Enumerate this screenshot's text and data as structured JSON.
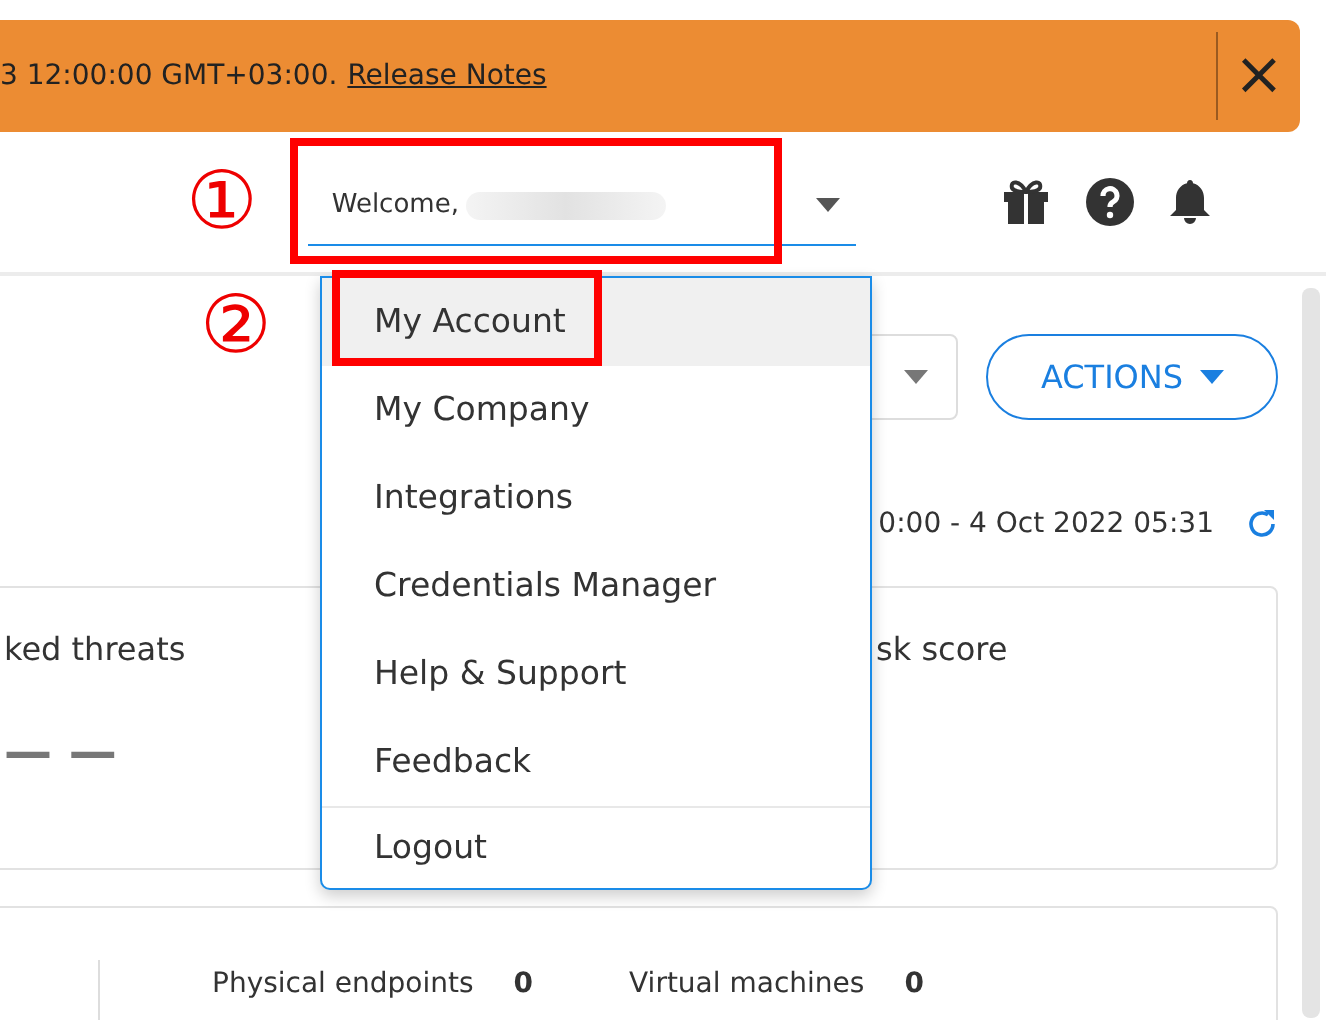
{
  "banner": {
    "text": "3 12:00:00 GMT+03:00.",
    "link": "Release Notes",
    "close": "×"
  },
  "header": {
    "welcome": "Welcome,",
    "annotation": "①"
  },
  "user_menu": {
    "annotation": "②",
    "items": [
      {
        "label": "My Account",
        "selected": true,
        "kind": "item"
      },
      {
        "label": "My Company",
        "selected": false,
        "kind": "item"
      },
      {
        "label": "Integrations",
        "selected": false,
        "kind": "item"
      },
      {
        "label": "Credentials Manager",
        "selected": false,
        "kind": "item"
      },
      {
        "label": "Help & Support",
        "selected": false,
        "kind": "item"
      },
      {
        "label": "Feedback",
        "selected": false,
        "kind": "item"
      },
      {
        "label": "Logout",
        "selected": false,
        "kind": "separated"
      }
    ]
  },
  "toolbar": {
    "actions": "ACTIONS",
    "date_range": "0:00 - 4 Oct 2022 05:31"
  },
  "summary_card": {
    "left_title": "ked threats",
    "left_value": "— —",
    "right_title": "sk score"
  },
  "endpoints_card": {
    "stats": [
      {
        "label": "Physical endpoints",
        "value": "0"
      },
      {
        "label": "Virtual machines",
        "value": "0"
      }
    ]
  }
}
